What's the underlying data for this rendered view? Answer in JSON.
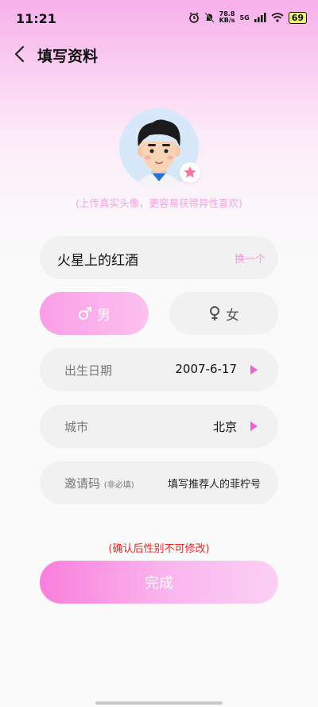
{
  "status_bar": {
    "time": "11:21",
    "net_speed_value": "78.8",
    "net_speed_unit": "KB/s",
    "network": "5G",
    "battery": "69"
  },
  "header": {
    "title": "填写资料"
  },
  "avatar": {
    "tip": "(上传真实头像，更容易获得异性喜欢)"
  },
  "nickname": {
    "value": "火星上的红酒",
    "change_label": "换一个"
  },
  "gender": {
    "male_label": "男",
    "female_label": "女",
    "selected": "male"
  },
  "birthday": {
    "label": "出生日期",
    "value": "2007-6-17"
  },
  "city": {
    "label": "城市",
    "value": "北京"
  },
  "invite": {
    "label": "邀请码",
    "hint": "(非必填)",
    "placeholder": "填写推荐人的菲柠号"
  },
  "notice": "(确认后性别不可修改)",
  "submit_label": "完成",
  "colors": {
    "accent_pink": "#f97fdc",
    "tip_pink": "#f2a3de",
    "notice_red": "#e22222"
  }
}
